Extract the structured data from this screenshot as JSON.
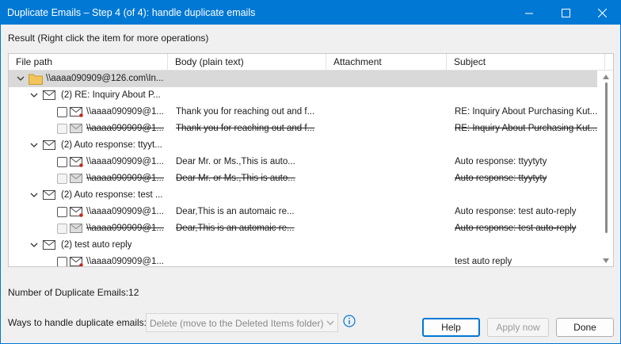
{
  "window": {
    "title": "Duplicate Emails – Step 4 (of 4): handle duplicate emails"
  },
  "result_label": "Result (Right click the item for more operations)",
  "columns": [
    "File path",
    "Body (plain text)",
    "Attachment",
    "Subject"
  ],
  "tree": {
    "root": {
      "label": "\\\\aaaa090909@126.com\\In..."
    },
    "groups": [
      {
        "label": "(2) RE: Inquiry About P...",
        "items": [
          {
            "path": "\\\\aaaa090909@1...",
            "body": "Thank you for reaching out and f...",
            "attachment": "",
            "subject": "RE: Inquiry About Purchasing Kut...",
            "duplicate": false
          },
          {
            "path": "\\\\aaaa090909@1...",
            "body": "Thank you for reaching out and f...",
            "attachment": "",
            "subject": "RE: Inquiry About Purchasing Kut...",
            "duplicate": true
          }
        ]
      },
      {
        "label": "(2) Auto response: ttyyt...",
        "items": [
          {
            "path": "\\\\aaaa090909@1...",
            "body": "Dear Mr. or Ms.,This is auto...",
            "attachment": "",
            "subject": "Auto response: ttyytyty",
            "duplicate": false
          },
          {
            "path": "\\\\aaaa090909@1...",
            "body": "Dear Mr. or Ms.,This is auto...",
            "attachment": "",
            "subject": "Auto response: ttyytyty",
            "duplicate": true
          }
        ]
      },
      {
        "label": "(2) Auto response: test ...",
        "items": [
          {
            "path": "\\\\aaaa090909@1...",
            "body": "Dear,This is an automaic re...",
            "attachment": "",
            "subject": "Auto response: test auto-reply",
            "duplicate": false
          },
          {
            "path": "\\\\aaaa090909@1...",
            "body": "Dear,This is an automaic re...",
            "attachment": "",
            "subject": "Auto response: test auto-reply",
            "duplicate": true
          }
        ]
      },
      {
        "label": "(2) test auto reply",
        "items": [
          {
            "path": "\\\\aaaa090909@1...",
            "body": "",
            "attachment": "",
            "subject": "test auto reply",
            "duplicate": false
          }
        ]
      }
    ]
  },
  "duplicate_count_text": "Number of Duplicate Emails:12",
  "ways_label": "Ways to handle duplicate emails:",
  "ways_select": {
    "value": "Delete (move to the Deleted Items folder)"
  },
  "buttons": {
    "help": "Help",
    "apply": "Apply now",
    "done": "Done"
  },
  "colors": {
    "titlebar": "#0078d4",
    "group_root_bg": "#d9d9d9",
    "mail_flag": "#c42b1c",
    "folder": "#f2c55c"
  },
  "icons": [
    "minimize-icon",
    "maximize-icon",
    "close-icon",
    "chevron-down-icon",
    "folder-icon",
    "mail-icon",
    "unread-mail-icon",
    "info-icon"
  ]
}
